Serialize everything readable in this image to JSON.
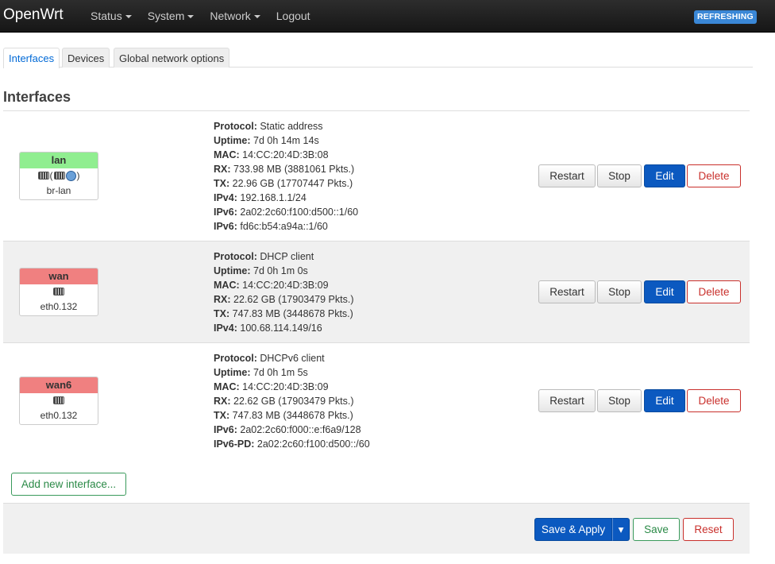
{
  "header": {
    "brand": "OpenWrt",
    "menu": [
      {
        "label": "Status",
        "has_caret": true
      },
      {
        "label": "System",
        "has_caret": true
      },
      {
        "label": "Network",
        "has_caret": true
      },
      {
        "label": "Logout",
        "has_caret": false
      }
    ],
    "badge": "REFRESHING"
  },
  "tabs": [
    "Interfaces",
    "Devices",
    "Global network options"
  ],
  "active_tab": "Interfaces",
  "section_title": "Interfaces",
  "interfaces": [
    {
      "name": "lan",
      "device": "br-lan",
      "color": "#90ee90",
      "details": [
        [
          "Protocol:",
          "Static address"
        ],
        [
          "Uptime:",
          "7d 0h 14m 14s"
        ],
        [
          "MAC:",
          "14:CC:20:4D:3B:08"
        ],
        [
          "RX:",
          "733.98 MB (3881061 Pkts.)"
        ],
        [
          "TX:",
          "22.96 GB (17707447 Pkts.)"
        ],
        [
          "IPv4:",
          "192.168.1.1/24"
        ],
        [
          "IPv6:",
          "2a02:2c60:f100:d500::1/60"
        ],
        [
          "IPv6:",
          "fd6c:b54:a94a::1/60"
        ]
      ]
    },
    {
      "name": "wan",
      "device": "eth0.132",
      "color": "#f08080",
      "details": [
        [
          "Protocol:",
          "DHCP client"
        ],
        [
          "Uptime:",
          "7d 0h 1m 0s"
        ],
        [
          "MAC:",
          "14:CC:20:4D:3B:09"
        ],
        [
          "RX:",
          "22.62 GB (17903479 Pkts.)"
        ],
        [
          "TX:",
          "747.83 MB (3448678 Pkts.)"
        ],
        [
          "IPv4:",
          "100.68.114.149/16"
        ]
      ]
    },
    {
      "name": "wan6",
      "device": "eth0.132",
      "color": "#f08080",
      "details": [
        [
          "Protocol:",
          "DHCPv6 client"
        ],
        [
          "Uptime:",
          "7d 0h 1m 5s"
        ],
        [
          "MAC:",
          "14:CC:20:4D:3B:09"
        ],
        [
          "RX:",
          "22.62 GB (17903479 Pkts.)"
        ],
        [
          "TX:",
          "747.83 MB (3448678 Pkts.)"
        ],
        [
          "IPv6:",
          "2a02:2c60:f000::e:f6a9/128"
        ],
        [
          "IPv6-PD:",
          "2a02:2c60:f100:d500::/60"
        ]
      ]
    }
  ],
  "row_actions": {
    "restart": "Restart",
    "stop": "Stop",
    "edit": "Edit",
    "delete": "Delete"
  },
  "add_interface": "Add new interface...",
  "footer": {
    "save_apply": "Save & Apply",
    "dropdown": "▾",
    "save": "Save",
    "reset": "Reset"
  },
  "colors": {
    "primary": "#0b59c0",
    "danger": "#c9302c",
    "positive": "#2b8a47",
    "badge": "#3a87d6"
  }
}
